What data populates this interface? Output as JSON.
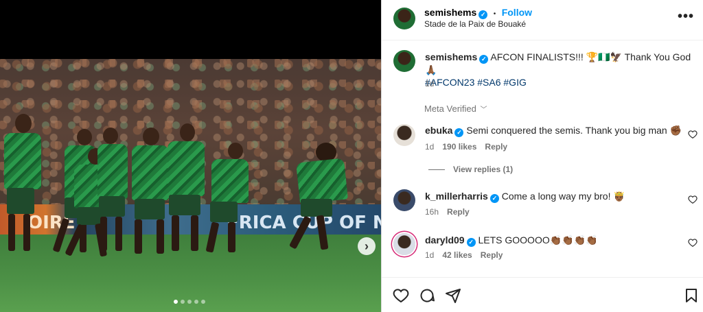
{
  "post": {
    "username": "semishems",
    "follow_label": "Follow",
    "separator": "•",
    "location": "Stade de la Paix de Bouaké",
    "more_icon": "more-options-icon"
  },
  "media": {
    "ad_text_left": "OIRE",
    "ad_text_right": "FRICA CUP OF NATI",
    "carousel": {
      "count": 5,
      "active": 1
    }
  },
  "caption": {
    "username": "semishems",
    "text": "AFCON FINALISTS!!! 🏆🇳🇬🦅 Thank You God 🙏🏾",
    "hashtags": [
      "#AFCON23",
      "#SA6",
      "#GIG"
    ],
    "time": "1d",
    "meta_verified_label": "Meta Verified"
  },
  "comments": [
    {
      "username": "ebuka",
      "text": "Semi conquered the semis. Thank you big man ✊🏾",
      "time": "1d",
      "likes": "190 likes",
      "reply": "Reply",
      "view_replies": "View replies (1)"
    },
    {
      "username": "k_millerharris",
      "text": "Come a long way my bro! 🤴🏾",
      "time": "16h",
      "likes": "",
      "reply": "Reply"
    },
    {
      "username": "daryld09",
      "text": "LETS GOOOOO👏🏾👏🏾👏🏾👏🏾",
      "time": "1d",
      "likes": "42 likes",
      "reply": "Reply"
    }
  ],
  "colors": {
    "accent": "#0095f6",
    "hashtag": "#00376b",
    "muted": "#737373",
    "border": "#dbdbdb"
  }
}
